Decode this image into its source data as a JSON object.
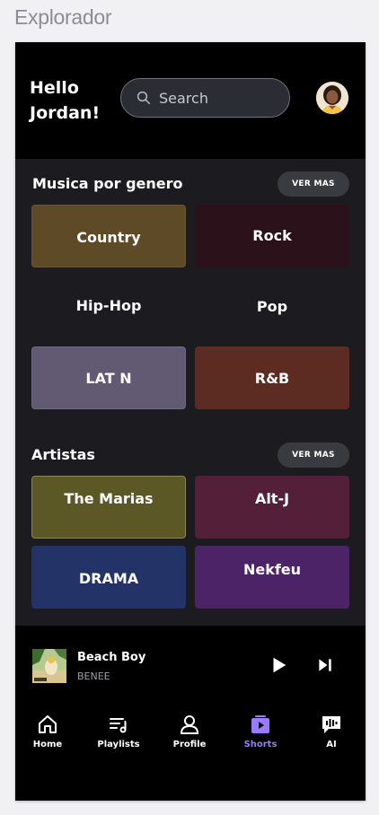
{
  "page": {
    "title": "Explorador"
  },
  "header": {
    "greeting": "Hello\nJordan!",
    "search_placeholder": "Search"
  },
  "genres": {
    "title": "Musica por genero",
    "more_label": "VER MAS",
    "items": [
      {
        "label": "Country",
        "color": "#5e4a26"
      },
      {
        "label": "Rock",
        "color": "#2b111a"
      },
      {
        "label": "Hip-Hop",
        "color": "#1c1c20"
      },
      {
        "label": "Pop",
        "color": "#1c1c20"
      },
      {
        "label": "LAT N",
        "color": "#625a72"
      },
      {
        "label": "R&B",
        "color": "#5c2b21"
      }
    ]
  },
  "artists": {
    "title": "Artistas",
    "more_label": "VER MAS",
    "items": [
      {
        "label": "The Marias",
        "color": "#5c5826"
      },
      {
        "label": "Alt-J",
        "color": "#541f39"
      },
      {
        "label": "DRAMA",
        "color": "#233368"
      },
      {
        "label": "Nekfeu",
        "color": "#4b2366"
      }
    ]
  },
  "player": {
    "track": "Beach Boy",
    "artist": "BENEE",
    "play_icon": "play-icon",
    "next_icon": "skip-next-icon"
  },
  "nav": {
    "items": [
      {
        "label": "Home",
        "icon": "home-icon",
        "active": false
      },
      {
        "label": "Playlists",
        "icon": "playlist-icon",
        "active": false
      },
      {
        "label": "Profile",
        "icon": "profile-icon",
        "active": false
      },
      {
        "label": "Shorts",
        "icon": "shorts-icon",
        "active": true
      },
      {
        "label": "AI",
        "icon": "ai-chat-icon",
        "active": false
      }
    ],
    "active_color": "#9a7bff"
  }
}
